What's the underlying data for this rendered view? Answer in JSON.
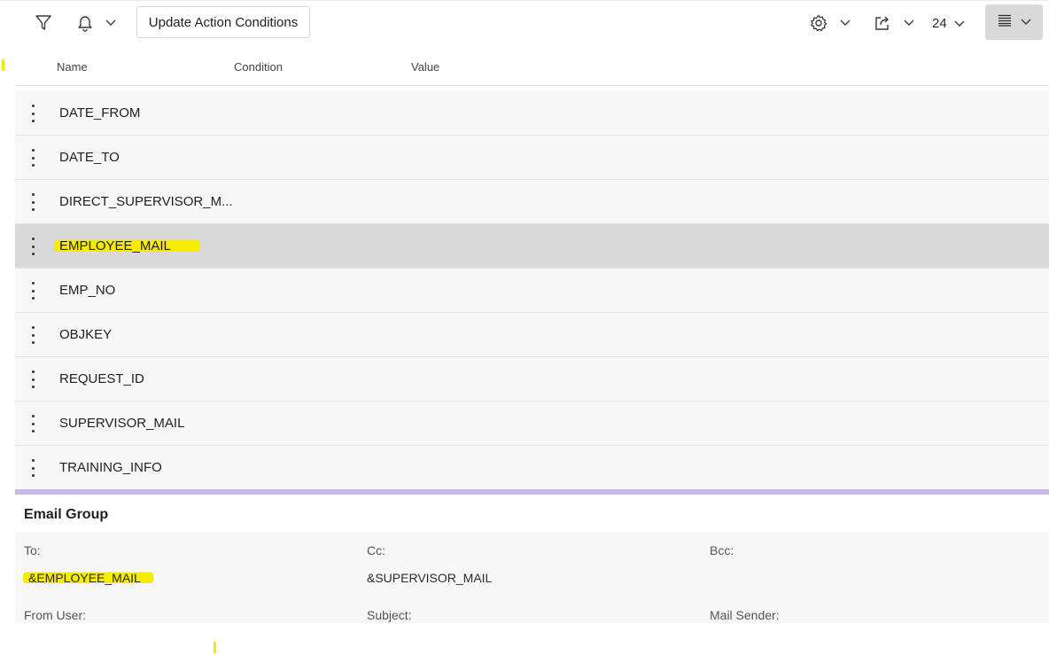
{
  "toolbar": {
    "filter_icon": "filter-icon",
    "bell_icon": "bell-icon",
    "update_label": "Update Action Conditions",
    "settings_icon": "gear-icon",
    "export_icon": "export-icon",
    "page_size": "24",
    "view_icon": "list-view-icon"
  },
  "table": {
    "columns": [
      "Name",
      "Condition",
      "Value"
    ],
    "rows": [
      {
        "name": "DATE_FROM"
      },
      {
        "name": "DATE_TO"
      },
      {
        "name": "DIRECT_SUPERVISOR_M..."
      },
      {
        "name": "EMPLOYEE_MAIL",
        "selected": true
      },
      {
        "name": "EMP_NO"
      },
      {
        "name": "OBJKEY"
      },
      {
        "name": "REQUEST_ID"
      },
      {
        "name": "SUPERVISOR_MAIL"
      },
      {
        "name": "TRAINING_INFO"
      }
    ]
  },
  "email_group": {
    "title": "Email Group",
    "to_label": "To:",
    "to_value": "&EMPLOYEE_MAIL",
    "cc_label": "Cc:",
    "cc_value": "&SUPERVISOR_MAIL",
    "bcc_label": "Bcc:",
    "from_user_label": "From User:",
    "subject_label": "Subject:",
    "mail_sender_label": "Mail Sender:"
  },
  "colors": {
    "highlight": "#f5ec00",
    "divider": "#c9b8ee",
    "selected_row": "#d9d9d9"
  }
}
